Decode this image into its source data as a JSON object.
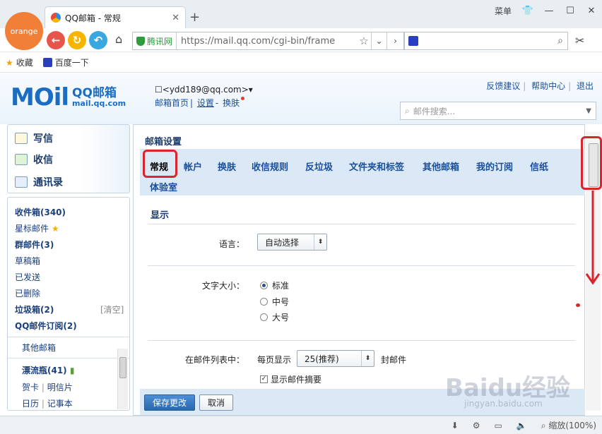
{
  "browser": {
    "logo_text": "orange",
    "tab_title": "QQ邮箱 - 常规",
    "new_tab": "+",
    "menu_label": "菜单",
    "cert_label": "腾讯网",
    "url": "https://mail.qq.com/cgi-bin/frame",
    "bookmarks": [
      "收藏",
      "百度一下"
    ],
    "zoom": "缩放(100%)"
  },
  "header": {
    "logo_big": "MOil",
    "logo_name": "QQ邮箱",
    "logo_domain": "mail.qq.com",
    "account": "<ydd189@qq.com>",
    "account_links": [
      "邮箱首页",
      "设置",
      "换肤"
    ],
    "top_links": [
      "反馈建议",
      "帮助中心",
      "退出"
    ],
    "search_placeholder": "邮件搜索..."
  },
  "nav": {
    "actions": [
      "写信",
      "收信",
      "通讯录"
    ],
    "folders": [
      {
        "label": "收件箱(340)"
      },
      {
        "label": "星标邮件"
      },
      {
        "label": "群邮件(3)"
      },
      {
        "label": "草稿箱"
      },
      {
        "label": "已发送"
      },
      {
        "label": "已删除"
      },
      {
        "label": "垃圾箱(2)"
      },
      {
        "label": "QQ邮件订阅(2)"
      },
      {
        "label": "其他邮箱"
      },
      {
        "label": "漂流瓶(41)"
      },
      {
        "label": "贺卡"
      },
      {
        "label": "明信片"
      },
      {
        "label": "日历"
      },
      {
        "label": "记事本"
      }
    ],
    "clean_label": "[清空]"
  },
  "settings": {
    "title": "邮箱设置",
    "tabs": [
      "常规",
      "帐户",
      "换肤",
      "收信规则",
      "反垃圾",
      "文件夹和标签",
      "其他邮箱",
      "我的订阅",
      "信纸",
      "体验室"
    ],
    "section": "显示",
    "language_label": "语言：",
    "language_value": "自动选择",
    "font_label": "文字大小：",
    "font_options": [
      "标准",
      "中号",
      "大号"
    ],
    "list_label": "在邮件列表中：",
    "per_page_label": "每页显示",
    "per_page_value": "25(推荐)",
    "per_page_unit": "封邮件",
    "summary_label": "显示邮件摘要",
    "save_label": "保存更改",
    "cancel_label": "取消"
  },
  "watermark": {
    "main": "Baidu经验",
    "sub": "jingyan.baidu.com"
  }
}
